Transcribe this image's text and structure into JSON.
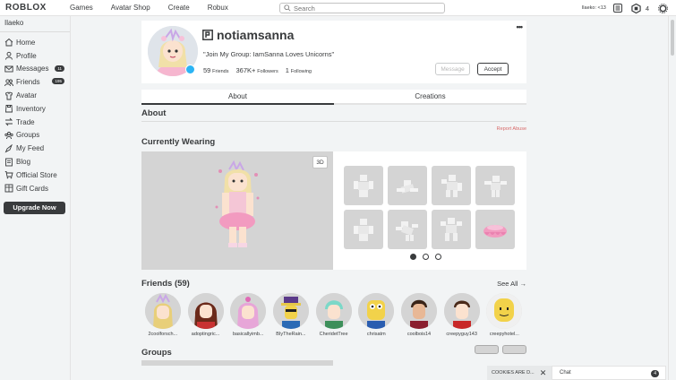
{
  "topbar": {
    "logo": "ROBLOX",
    "nav": [
      "Games",
      "Avatar Shop",
      "Create",
      "Robux"
    ],
    "search_placeholder": "Search",
    "user_label": "Ilaeko: <13",
    "robux_count": "4"
  },
  "sidebar": {
    "username": "Ilaeko",
    "items": [
      {
        "label": "Home",
        "icon": "home-icon",
        "badge": ""
      },
      {
        "label": "Profile",
        "icon": "profile-icon",
        "badge": ""
      },
      {
        "label": "Messages",
        "icon": "messages-icon",
        "badge": "11"
      },
      {
        "label": "Friends",
        "icon": "friends-icon",
        "badge": "195"
      },
      {
        "label": "Avatar",
        "icon": "avatar-icon",
        "badge": ""
      },
      {
        "label": "Inventory",
        "icon": "inventory-icon",
        "badge": ""
      },
      {
        "label": "Trade",
        "icon": "trade-icon",
        "badge": ""
      },
      {
        "label": "Groups",
        "icon": "groups-icon",
        "badge": ""
      },
      {
        "label": "My Feed",
        "icon": "feed-icon",
        "badge": ""
      },
      {
        "label": "Blog",
        "icon": "blog-icon",
        "badge": ""
      },
      {
        "label": "Official Store",
        "icon": "store-icon",
        "badge": ""
      },
      {
        "label": "Gift Cards",
        "icon": "giftcard-icon",
        "badge": ""
      }
    ],
    "upgrade_label": "Upgrade Now"
  },
  "profile": {
    "name": "notiamsanna",
    "status": "\"Join My Group: IamSanna Loves Unicorns\"",
    "friends_count": "59",
    "friends_label": "Friends",
    "followers_count": "367K+",
    "followers_label": "Followers",
    "following_count": "1",
    "following_label": "Following",
    "more_label": "•••",
    "message_label": "Message",
    "accept_label": "Accept"
  },
  "tabs": [
    "About",
    "Creations"
  ],
  "about": {
    "heading": "About",
    "report_label": "Report Abuse"
  },
  "wearing": {
    "heading": "Currently Wearing",
    "btn_3d": "3D"
  },
  "friends": {
    "heading": "Friends (59)",
    "see_all": "See All →",
    "list": [
      "2coolforsch...",
      "adoptingric...",
      "basicallyimb...",
      "BIyTheRain...",
      "CheridetTree",
      "chrisatm",
      "coolbois14",
      "creepyguy143",
      "creepyhotel..."
    ]
  },
  "groups": {
    "heading": "Groups"
  },
  "cookies_label": "COOKIES ARE D...",
  "chat": {
    "label": "Chat",
    "badge": "4"
  },
  "colors": {
    "accent": "#393b3d",
    "premium": "#2bb4f4",
    "report": "#d86868"
  }
}
